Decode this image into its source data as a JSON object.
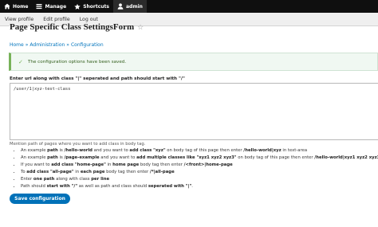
{
  "toolbar": {
    "items": [
      {
        "label": "Home",
        "icon": "home-icon"
      },
      {
        "label": "Manage",
        "icon": "menu-icon"
      },
      {
        "label": "Shortcuts",
        "icon": "star-icon"
      },
      {
        "label": "admin",
        "icon": "user-icon"
      }
    ]
  },
  "tabs": [
    "View profile",
    "Edit profile",
    "Log out"
  ],
  "page": {
    "title": "Page Specific Class SettingsForm",
    "star_glyph": "☆"
  },
  "breadcrumb": {
    "items": [
      "Home",
      "Administration",
      "Configuration"
    ],
    "separator": "»"
  },
  "status": {
    "message": "The configuration options have been saved.",
    "check_glyph": "✓"
  },
  "form": {
    "label": "Enter url along with class \"|\" seperated and path should start with \"/\"",
    "value": "/user/1|xyz-test-class",
    "help_intro": "Mention path of pages where you want to add class in body tag.",
    "help_items": [
      [
        {
          "t": "An example "
        },
        {
          "t": "path",
          "b": true
        },
        {
          "t": " is "
        },
        {
          "t": "/hello-world",
          "b": true
        },
        {
          "t": " and you want to "
        },
        {
          "t": "add class \"xyz\"",
          "b": true
        },
        {
          "t": " on body tag of this page then enter "
        },
        {
          "t": "/hello-world|xyz",
          "b": true
        },
        {
          "t": " in text-area"
        }
      ],
      [
        {
          "t": "An example "
        },
        {
          "t": "path",
          "b": true
        },
        {
          "t": " is "
        },
        {
          "t": "/page-example",
          "b": true
        },
        {
          "t": " and you want to "
        },
        {
          "t": "add multiple classes like \"xyz1 xyz2 xyz3\"",
          "b": true
        },
        {
          "t": " on body tag of this page then enter "
        },
        {
          "t": "/hello-world|xyz1 xyz2 xyz3",
          "b": true
        }
      ],
      [
        {
          "t": "If you want to "
        },
        {
          "t": "add class \"home-page\"",
          "b": true
        },
        {
          "t": " in "
        },
        {
          "t": "home page",
          "b": true
        },
        {
          "t": " body tag then enter "
        },
        {
          "t": "/<front>|home-page",
          "b": true
        }
      ],
      [
        {
          "t": "To "
        },
        {
          "t": "add class \"all-page\"",
          "b": true
        },
        {
          "t": " in "
        },
        {
          "t": "each page",
          "b": true
        },
        {
          "t": " body tag then enter "
        },
        {
          "t": "/*|all-page",
          "b": true
        }
      ],
      [
        {
          "t": "Enter "
        },
        {
          "t": "one path",
          "b": true
        },
        {
          "t": " along with class "
        },
        {
          "t": "per line",
          "b": true
        }
      ],
      [
        {
          "t": "Path should "
        },
        {
          "t": "start with \"/\"",
          "b": true
        },
        {
          "t": " as well as path and class should "
        },
        {
          "t": "seperated with \"|\"",
          "b": true
        },
        {
          "t": "."
        }
      ]
    ],
    "save_label": "Save configuration"
  },
  "colors": {
    "toolbar_bg": "#0f0f0f",
    "link": "#0074bd",
    "status_border": "#77b259",
    "status_bg": "#f0f8f2",
    "button": "#0071b8"
  }
}
